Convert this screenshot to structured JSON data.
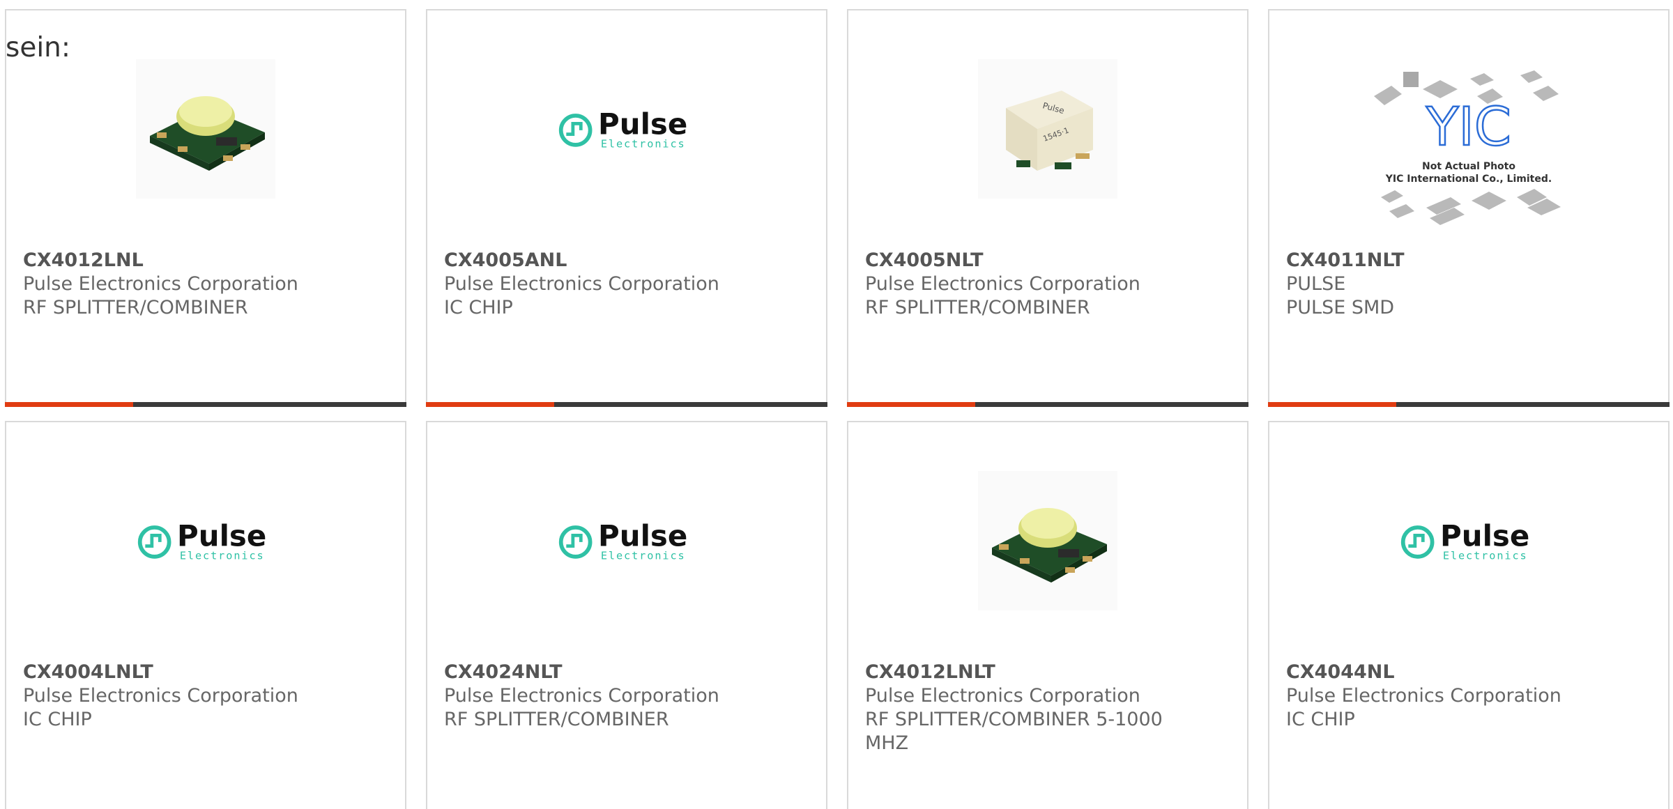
{
  "intro": {
    "text": "sein:"
  },
  "products": [
    {
      "part": "CX4012LNL",
      "manufacturer": "Pulse Electronics Corporation",
      "description": "RF SPLITTER/COMBINER",
      "image": "component-photo"
    },
    {
      "part": "CX4005ANL",
      "manufacturer": "Pulse Electronics Corporation",
      "description": "IC CHIP",
      "image": "pulse-logo"
    },
    {
      "part": "CX4005NLT",
      "manufacturer": "Pulse Electronics Corporation",
      "description": "RF SPLITTER/COMBINER",
      "image": "component-photo"
    },
    {
      "part": "CX4011NLT",
      "manufacturer": "PULSE",
      "description": "PULSE SMD",
      "image": "yic-placeholder"
    },
    {
      "part": "CX4004LNLT",
      "manufacturer": "Pulse Electronics Corporation",
      "description": "IC CHIP",
      "image": "pulse-logo"
    },
    {
      "part": "CX4024NLT",
      "manufacturer": "Pulse Electronics Corporation",
      "description": "RF SPLITTER/COMBINER",
      "image": "pulse-logo"
    },
    {
      "part": "CX4012LNLT",
      "manufacturer": "Pulse Electronics Corporation",
      "description": "RF SPLITTER/COMBINER 5-1000 MHZ",
      "image": "component-photo"
    },
    {
      "part": "CX4044NL",
      "manufacturer": "Pulse Electronics Corporation",
      "description": "IC CHIP",
      "image": "pulse-logo"
    }
  ],
  "logos": {
    "pulse": {
      "word": "Pulse",
      "sub": "Electronics"
    },
    "yic": {
      "line1": "Not Actual Photo",
      "line2": "YIC International Co., Limited."
    }
  },
  "colors": {
    "accent": "#e03c12",
    "bar": "#3a3a3a",
    "pulse_teal": "#2fc1a5",
    "yic_blue": "#2b6cd6"
  }
}
